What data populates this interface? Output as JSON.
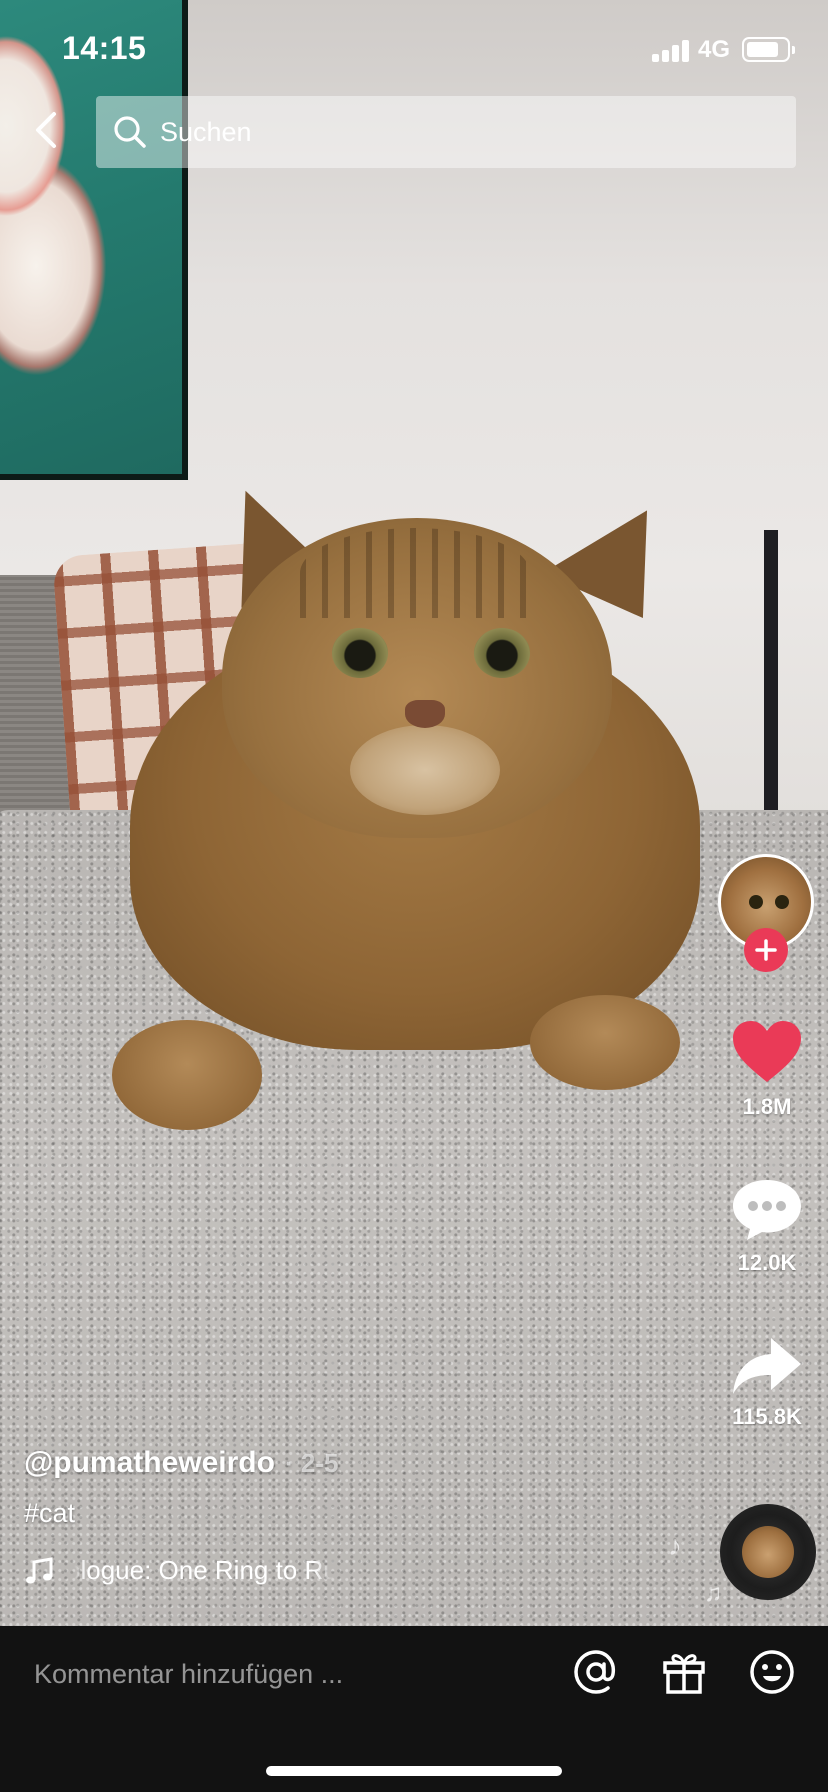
{
  "status_bar": {
    "time": "14:15",
    "network": "4G",
    "battery_level": 0.85
  },
  "search": {
    "placeholder": "Suchen"
  },
  "video": {
    "description": "",
    "author": {
      "handle": "@pumatheweirdo",
      "date": "· 2-5"
    },
    "hashtag": "#cat",
    "music_title": "ologue: One Ring to Rule Th"
  },
  "actions": {
    "likes": "1.8M",
    "comments": "12.0K",
    "shares": "115.8K"
  },
  "comment_bar": {
    "placeholder": "Kommentar hinzufügen ..."
  },
  "icons": {
    "back": "back-chevron-icon",
    "search": "search-icon",
    "like": "heart-icon",
    "comment": "comment-bubble-icon",
    "share": "share-arrow-icon",
    "follow": "plus-icon",
    "music": "music-note-icon",
    "mention": "at-sign-icon",
    "gift": "gift-icon",
    "emoji": "emoji-icon"
  },
  "colors": {
    "like_red": "#ea3a57",
    "follow_red": "#ea3a57",
    "bar_background": "#121212"
  }
}
